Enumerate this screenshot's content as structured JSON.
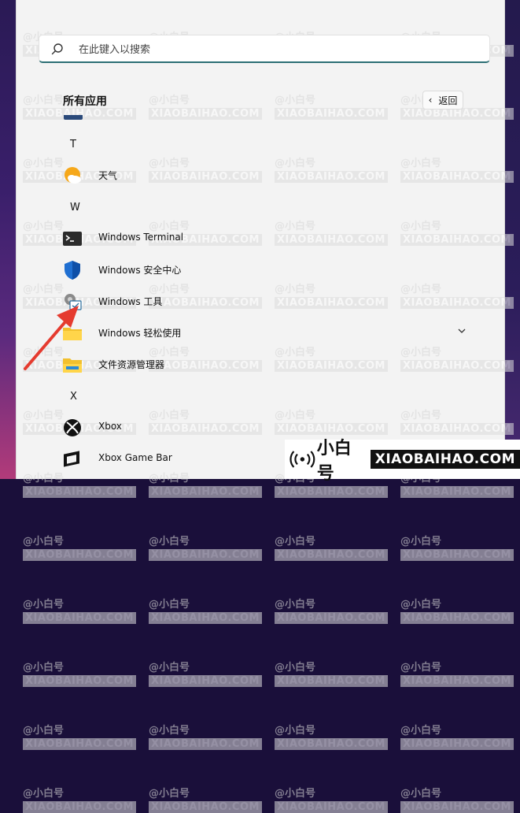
{
  "search": {
    "placeholder": "在此键入以搜索"
  },
  "section": {
    "title": "所有应用",
    "back_label": "返回"
  },
  "groups": [
    {
      "letter": "T",
      "apps": [
        {
          "name": "天气",
          "icon": "weather-icon"
        }
      ]
    },
    {
      "letter": "W",
      "apps": [
        {
          "name": "Windows Terminal",
          "icon": "terminal-icon"
        },
        {
          "name": "Windows 安全中心",
          "icon": "shield-icon"
        },
        {
          "name": "Windows 工具",
          "icon": "tools-icon"
        },
        {
          "name": "Windows 轻松使用",
          "icon": "folder-icon",
          "expandable": true
        },
        {
          "name": "文件资源管理器",
          "icon": "file-explorer-icon"
        }
      ]
    },
    {
      "letter": "X",
      "apps": [
        {
          "name": "Xbox",
          "icon": "xbox-icon"
        },
        {
          "name": "Xbox Game Bar",
          "icon": "xbox-game-bar-icon"
        }
      ]
    }
  ],
  "watermark": {
    "line1": "@小白号",
    "line2": "XIAOBAIHAO.COM"
  },
  "brand": {
    "cn": "小白号",
    "en": "XIAOBAIHAO.COM"
  },
  "colors": {
    "accent": "#2c6f74",
    "arrow": "#e53b2f",
    "panel": "#f3f3f3"
  }
}
